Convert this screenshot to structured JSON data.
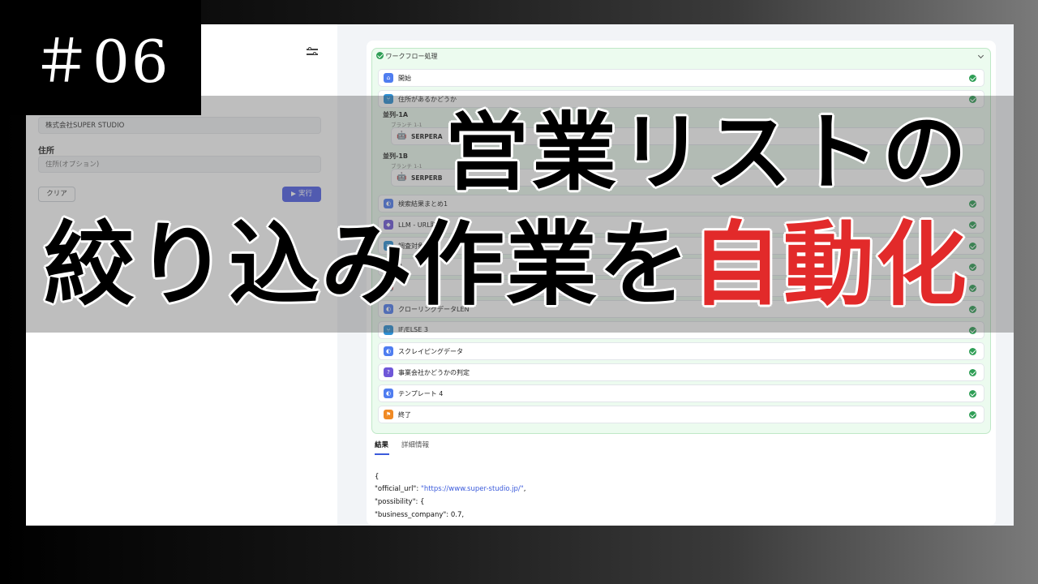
{
  "episode": "＃06",
  "title": {
    "line1": "営業リストの",
    "line2_prefix": "絞り込み作業を",
    "line2_accent": "自動化"
  },
  "colors": {
    "accent": "#e22a2a",
    "primary_button": "#4f5fe8",
    "success": "#2e9e55"
  },
  "form": {
    "company_value": "株式会社SUPER STUDIO",
    "address_label": "住所",
    "address_placeholder": "住所(オプション)",
    "clear_label": "クリア",
    "run_label": "実行"
  },
  "workflow": {
    "header": "ワークフロー処理",
    "steps": [
      {
        "label": "開始",
        "icon": "home-icon"
      },
      {
        "label": "住所があるかどうか",
        "icon": "branch-icon"
      },
      {
        "label": "並列-1A",
        "sub": "ブランチ 1-1",
        "node": "SERPERA",
        "icon": "robot-icon"
      },
      {
        "label": "並列-1B",
        "sub": "ブランチ 1-1",
        "node": "SERPERB",
        "icon": "robot-icon"
      },
      {
        "label": "検索結果まとめ1",
        "icon": "template-icon"
      },
      {
        "label": "LLM - URL取得",
        "icon": "llm-icon"
      },
      {
        "label": "調査対象URL",
        "icon": "code-icon"
      },
      {
        "label": "2",
        "icon": "code-icon"
      },
      {
        "label": "",
        "icon": "robot-icon"
      },
      {
        "label": "クローリングデータLEN",
        "icon": "template-icon"
      },
      {
        "label": "IF/ELSE 3",
        "icon": "branch-icon"
      },
      {
        "label": "スクレイピングデータ",
        "icon": "template-icon"
      },
      {
        "label": "事業会社かどうかの判定",
        "icon": "question-icon"
      },
      {
        "label": "テンプレート 4",
        "icon": "template-icon"
      },
      {
        "label": "終了",
        "icon": "end-icon"
      }
    ]
  },
  "tabs": {
    "result": "結果",
    "details": "詳細情報"
  },
  "result_json": {
    "line1": "{",
    "line2_key": "\"official_url\": ",
    "line2_value": "\"https://www.super-studio.jp/\"",
    "line2_end": ",",
    "line3": "\"possibility\": {",
    "line4": "\"business_company\": 0.7,"
  }
}
